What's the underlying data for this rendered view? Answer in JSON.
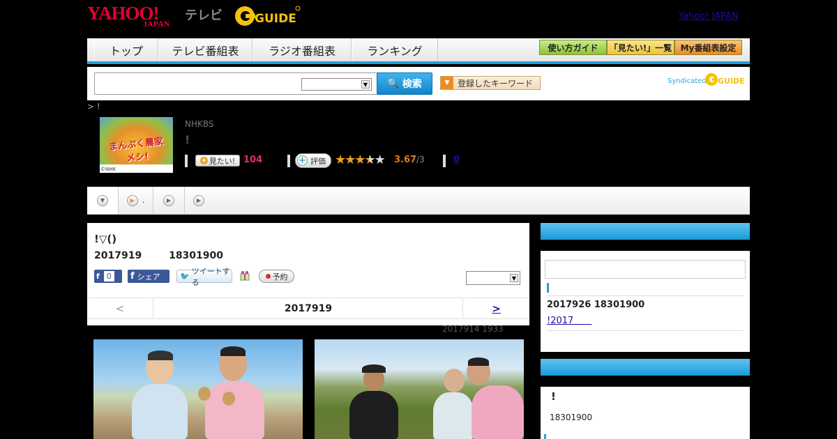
{
  "header": {
    "logo_yahoo": "YAHOO!",
    "logo_japan": "JAPAN",
    "logo_tv": "テレビ",
    "logo_gguide": "GUIDE",
    "yahoo_japan_link": "Yahoo! JAPAN",
    "link_dot": ".",
    "small_dot": "."
  },
  "nav": {
    "tabs": [
      {
        "label": "トップ"
      },
      {
        "label": "テレビ番組表"
      },
      {
        "label": "ラジオ番組表"
      },
      {
        "label": "ランキング"
      }
    ],
    "buttons": [
      {
        "label": "使い方ガイド",
        "color": "#9cd24a"
      },
      {
        "label": "「見たい!」一覧",
        "color": "#f2cf4a"
      },
      {
        "label": "My番組表設定",
        "color": "#f09a2a"
      }
    ],
    "accent_color": "#1ea0e0"
  },
  "search": {
    "input_value": "",
    "select_value": "",
    "button_label": "検索",
    "keyword_button": "登録したキーワード",
    "syndicated_label": "Syndicated",
    "syndicated_logo": "GUIDE"
  },
  "breadcrumb": "> !",
  "program": {
    "thumb_title": "まんぷく農家メシ!",
    "thumb_copyright": "©NHK",
    "station": "NHKBS",
    "name": "!",
    "mitai_label": "見たい!",
    "mitai_count": "104",
    "hyoka_label": "評価",
    "rating": "3.67",
    "rating_sub": "/3",
    "rating_stars": 3.67,
    "review_count": "0"
  },
  "tabstrip": {
    "items": [
      {
        "label": "",
        "icon": "triangle-down-icon"
      },
      {
        "label": ".",
        "icon": "play-icon"
      },
      {
        "label": "",
        "icon": "play-icon"
      },
      {
        "label": "",
        "icon": "play-icon"
      }
    ]
  },
  "episode": {
    "title": "!▽()",
    "date": "2017919",
    "time": "18301900",
    "fb_like_count": "0",
    "fb_share_label": "シェア",
    "tweet_label": "ツイートする",
    "yoyaku_label": "予約",
    "select_value": "",
    "nav_prev": "<",
    "nav_date": "2017919",
    "nav_next": ">",
    "updated": "2017914  1933"
  },
  "sidebar": {
    "box1": {
      "input_value": "",
      "date": "2017926  18301900",
      "link": "!2017　　"
    },
    "box2": {
      "ex": "!",
      "time": "18301900"
    }
  }
}
